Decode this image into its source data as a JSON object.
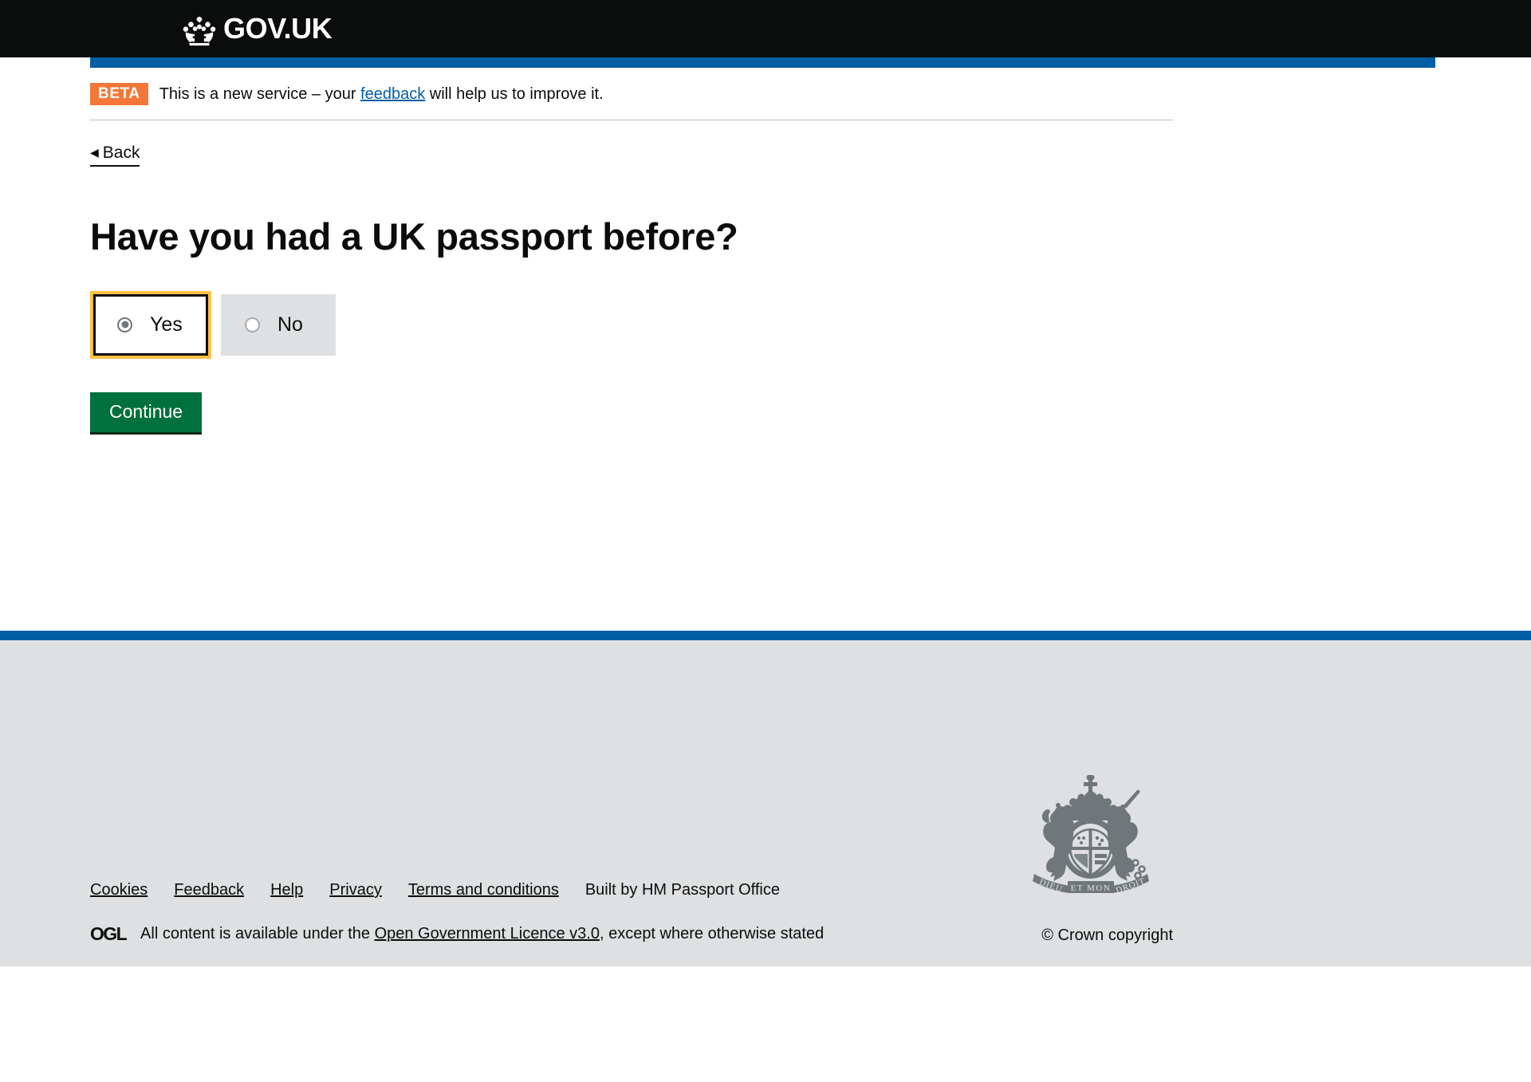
{
  "header": {
    "logo_text": "GOV.UK",
    "logo_icon": "crown-icon"
  },
  "phase_banner": {
    "tag": "BETA",
    "text_before": "This is a new service – your",
    "link": "feedback",
    "text_after": "will help us to improve it."
  },
  "back": {
    "arrow": "◀",
    "label": "Back"
  },
  "main": {
    "question": "Have you had a UK passport before?",
    "options": [
      {
        "label": "Yes",
        "selected": true
      },
      {
        "label": "No",
        "selected": false
      }
    ],
    "continue_label": "Continue"
  },
  "footer": {
    "links": [
      "Cookies",
      "Feedback",
      "Help",
      "Privacy",
      "Terms and conditions"
    ],
    "built_by": "Built by HM Passport Office",
    "ogl_logo": "OGL",
    "licence_before": "All content is available under the",
    "licence_link": "Open Government Licence v3.0",
    "licence_after": ", except where otherwise stated",
    "copyright": "© Crown copyright",
    "crest_icon": "royal-coat-of-arms-icon"
  },
  "colors": {
    "header_black": "#0b0c0c",
    "gov_blue": "#005ea5",
    "beta_orange": "#f47738",
    "button_green": "#00703c",
    "focus_yellow": "#ffbf47",
    "footer_grey": "#dee0e2",
    "link_blue": "#005ea5"
  }
}
